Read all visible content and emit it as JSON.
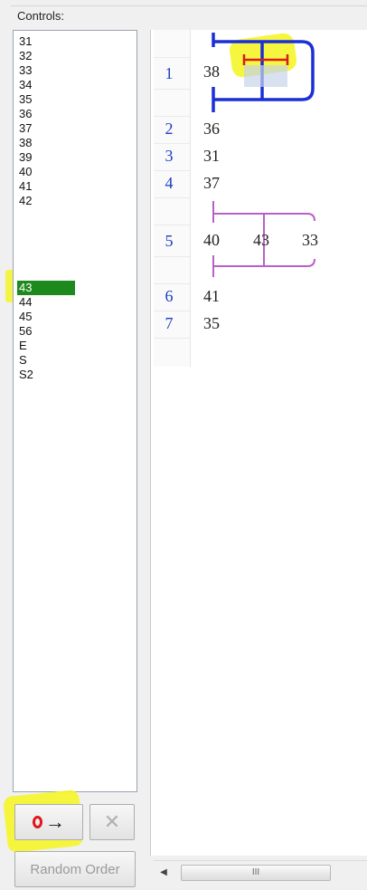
{
  "panel": {
    "title": "Controls:"
  },
  "controls": {
    "items": [
      "31",
      "32",
      "33",
      "34",
      "35",
      "36",
      "37",
      "38",
      "39",
      "40",
      "41",
      "42",
      "43",
      "44",
      "45",
      "56",
      "E",
      "S",
      "S2"
    ],
    "selected": "43"
  },
  "buttons": {
    "go_icon": "circle-arrow-icon",
    "remove_label": "✕",
    "random_label": "Random Order"
  },
  "course": {
    "rows": [
      {
        "num": "1",
        "control": "38"
      },
      {
        "num": "2",
        "control": "36"
      },
      {
        "num": "3",
        "control": "31"
      },
      {
        "num": "4",
        "control": "37"
      },
      {
        "num": "5",
        "controls": [
          "40",
          "43",
          "33"
        ]
      },
      {
        "num": "6",
        "control": "41"
      },
      {
        "num": "7",
        "control": "35"
      }
    ]
  },
  "scrollbar": {
    "arrow": "◀",
    "grip": "III"
  },
  "colors": {
    "selection": "#1e8a1e",
    "highlight": "#f5f52a",
    "leg_blue": "#1a2fd6",
    "leg_red": "#d81b1b",
    "variation_purple": "#b860c8",
    "row_number": "#1d3fbf"
  }
}
